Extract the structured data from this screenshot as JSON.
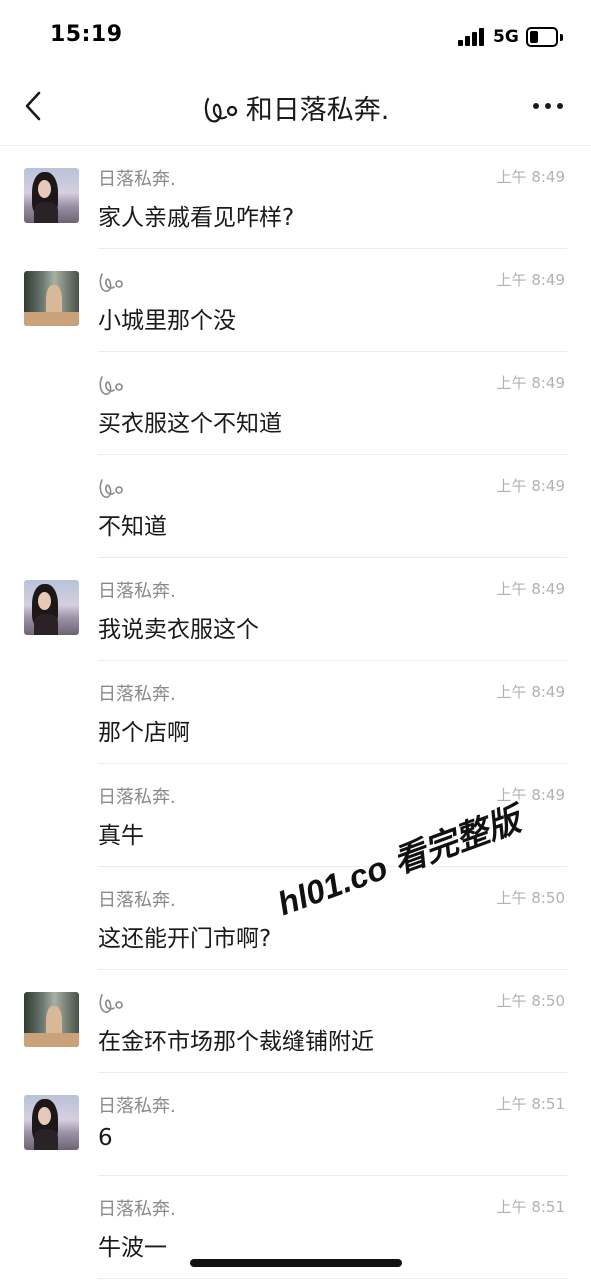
{
  "status_bar": {
    "time": "15:19",
    "network": "5G",
    "battery_level": 0.35
  },
  "header": {
    "title": "和日落私奔.",
    "back_icon": "chevron-left-icon",
    "more_icon": "more-dots-icon",
    "title_icon": "doodle-icon"
  },
  "messages": [
    {
      "sender": "日落私奔.",
      "sender_type": "name",
      "avatar": "girl",
      "time": "上午 8:49",
      "text": "家人亲戚看见咋样?"
    },
    {
      "sender": "",
      "sender_type": "icon",
      "avatar": "room",
      "time": "上午 8:49",
      "text": "小城里那个没"
    },
    {
      "sender": "",
      "sender_type": "icon",
      "avatar": "",
      "time": "上午 8:49",
      "text": "买衣服这个不知道"
    },
    {
      "sender": "",
      "sender_type": "icon",
      "avatar": "",
      "time": "上午 8:49",
      "text": "不知道"
    },
    {
      "sender": "日落私奔.",
      "sender_type": "name",
      "avatar": "girl",
      "time": "上午 8:49",
      "text": "我说卖衣服这个"
    },
    {
      "sender": "日落私奔.",
      "sender_type": "name",
      "avatar": "",
      "time": "上午 8:49",
      "text": "那个店啊"
    },
    {
      "sender": "日落私奔.",
      "sender_type": "name",
      "avatar": "",
      "time": "上午 8:49",
      "text": "真牛"
    },
    {
      "sender": "日落私奔.",
      "sender_type": "name",
      "avatar": "",
      "time": "上午 8:50",
      "text": "这还能开门市啊?"
    },
    {
      "sender": "",
      "sender_type": "icon",
      "avatar": "room",
      "time": "上午 8:50",
      "text": "在金环市场那个裁缝铺附近"
    },
    {
      "sender": "日落私奔.",
      "sender_type": "name",
      "avatar": "girl",
      "time": "上午 8:51",
      "text": "6"
    },
    {
      "sender": "日落私奔.",
      "sender_type": "name",
      "avatar": "",
      "time": "上午 8:51",
      "text": "牛波一"
    }
  ],
  "watermark": "hl01.co 看完整版"
}
